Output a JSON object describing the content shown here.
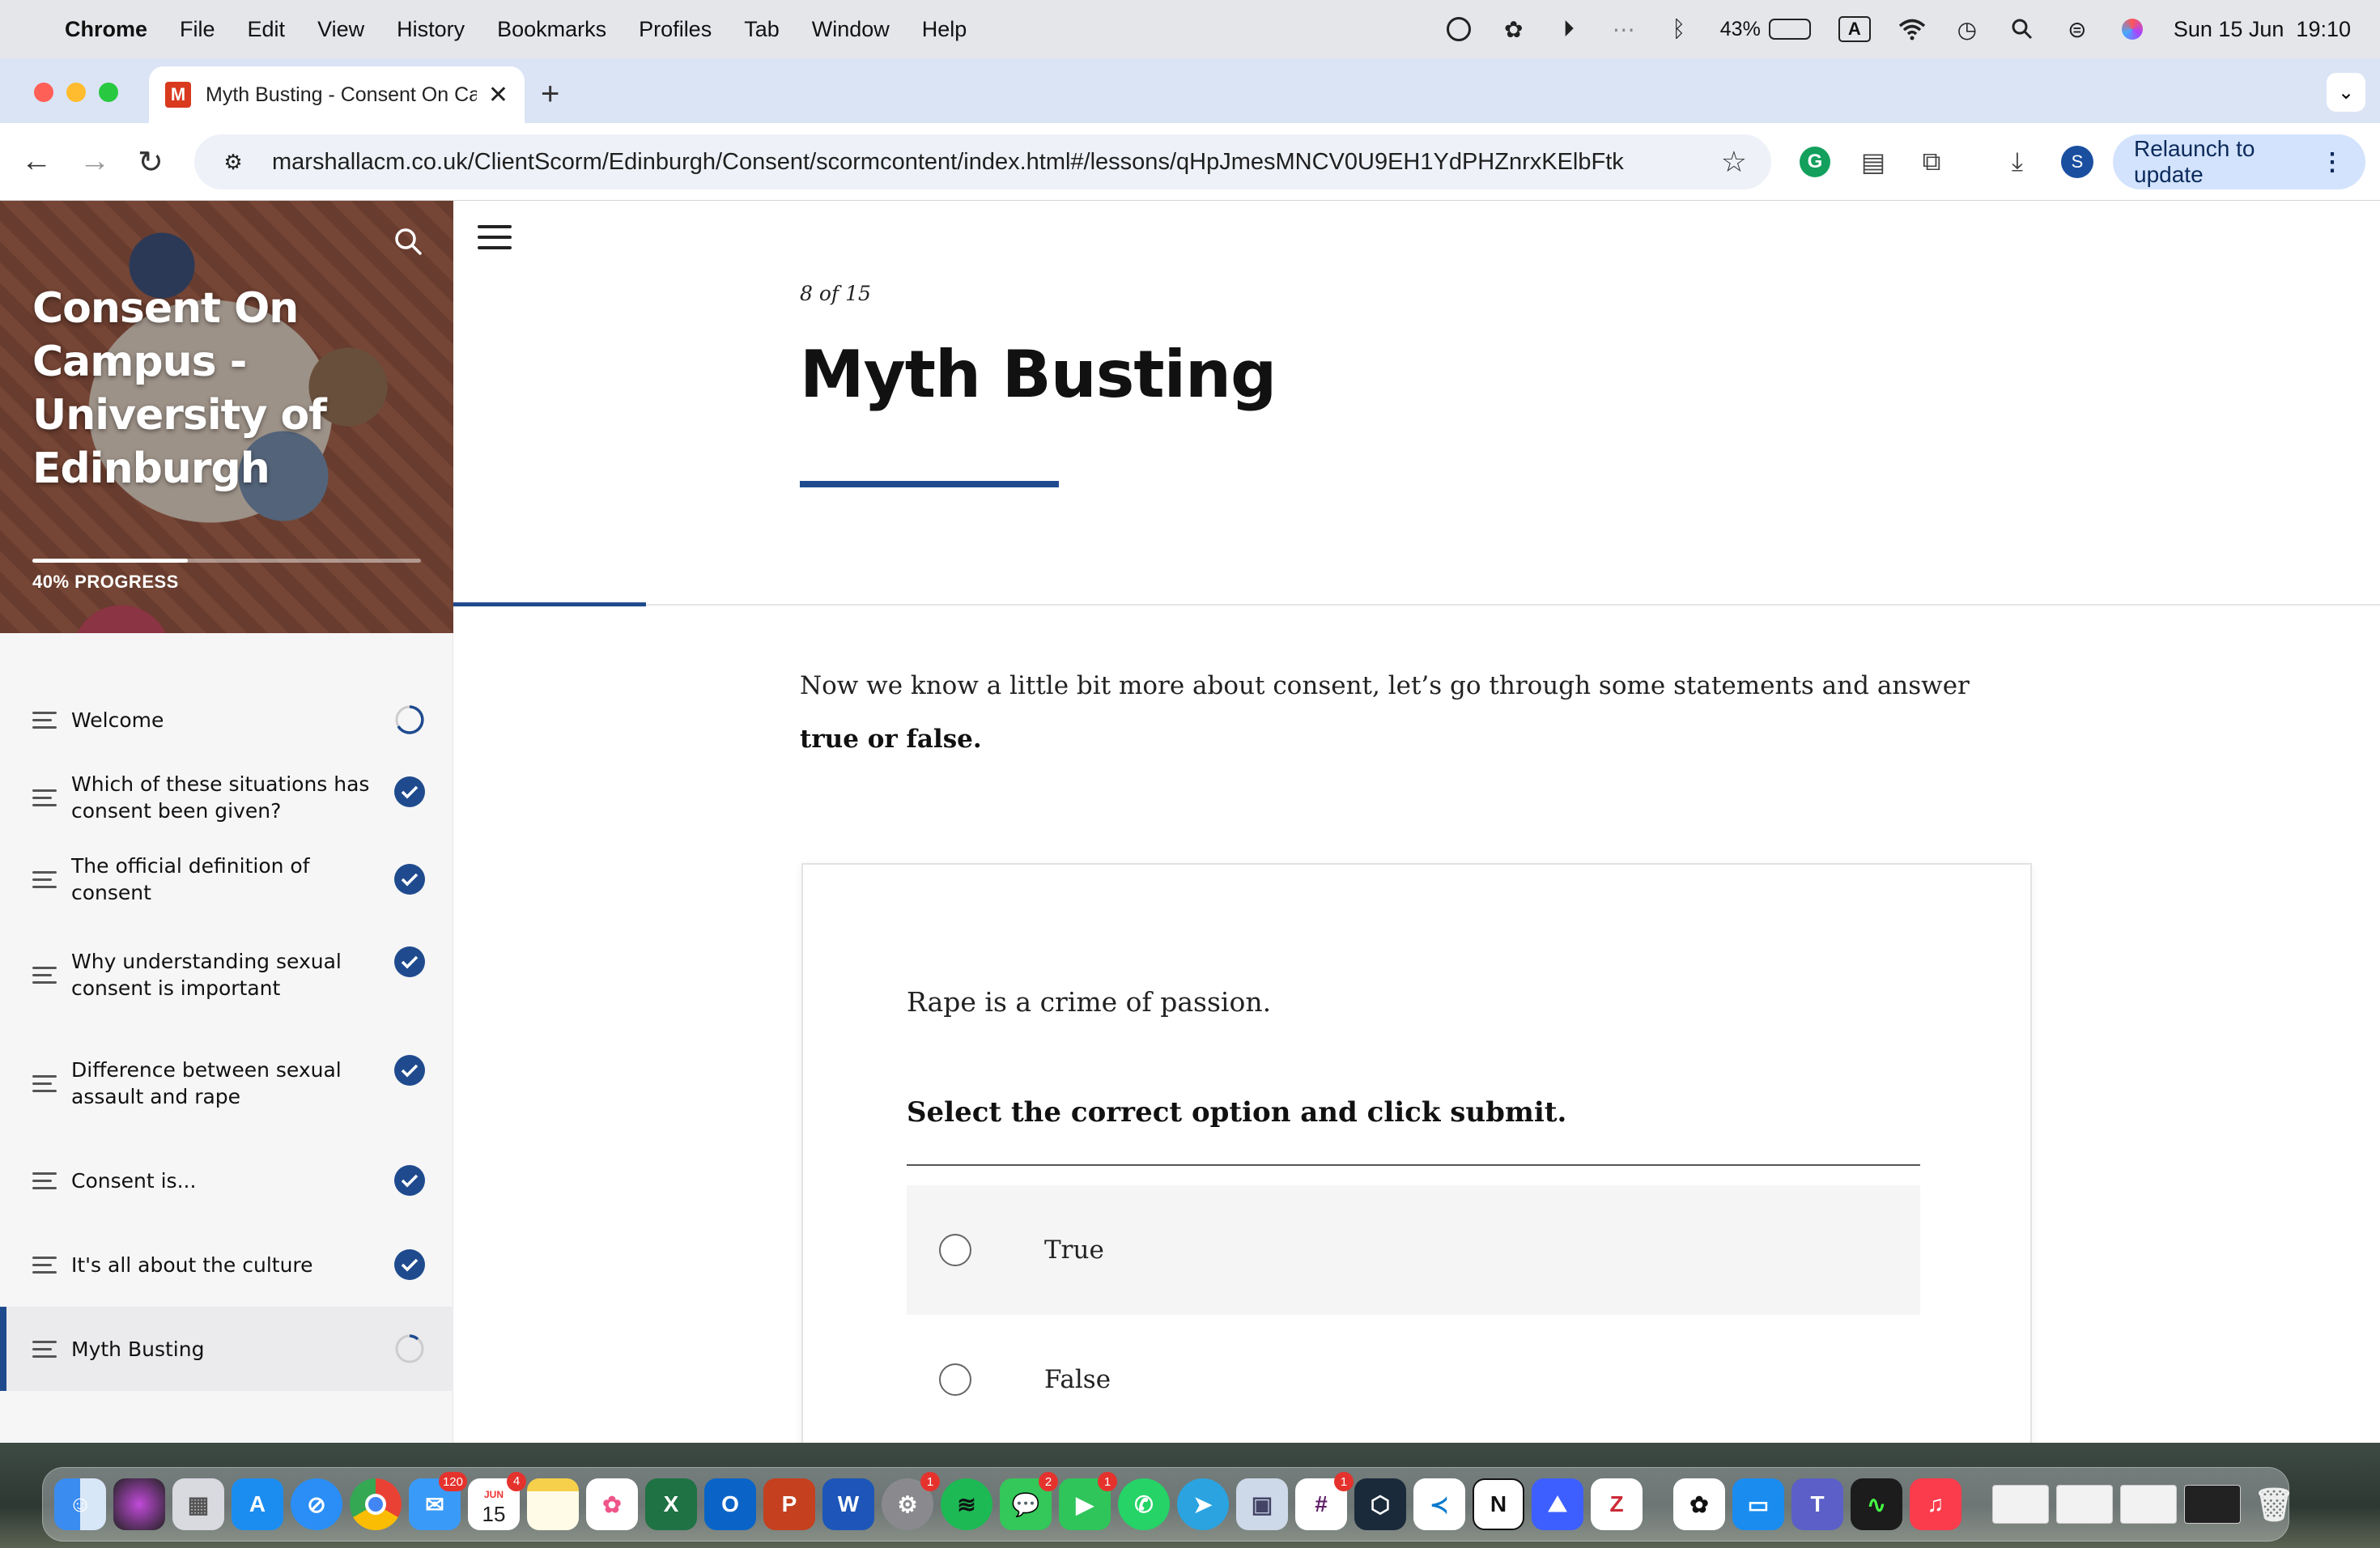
{
  "menubar": {
    "app": "Chrome",
    "items": [
      "File",
      "Edit",
      "View",
      "History",
      "Bookmarks",
      "Profiles",
      "Tab",
      "Window",
      "Help"
    ],
    "battery": "43%",
    "input_source": "A",
    "datetime": "Sun 15 Jun  19:10"
  },
  "browser": {
    "tab_title": "Myth Busting - Consent On Campus",
    "tab_favicon": "M",
    "url": "marshallacm.co.uk/ClientScorm/Edinburgh/Consent/scormcontent/index.html#/lessons/qHpJmesMNCV0U9EH1YdPHZnrxKElbFtk",
    "profile_initial": "S",
    "relaunch_label": "Relaunch to update",
    "colors": {
      "tab_strip": "#dbe4f5",
      "relaunch_bg": "#d3e3fd"
    }
  },
  "sidebar": {
    "course_title": "Consent On Campus - University of Edinburgh",
    "progress_percent": 40,
    "progress_label": "40% PROGRESS",
    "lessons": [
      {
        "label": "Welcome",
        "status": "in-progress"
      },
      {
        "label": "Which of these situations has consent been given?",
        "status": "complete"
      },
      {
        "label": "The official definition of consent",
        "status": "complete"
      },
      {
        "label": "Why understanding sexual consent is important",
        "status": "complete"
      },
      {
        "label": "Difference between sexual assault and rape",
        "status": "complete"
      },
      {
        "label": "Consent is...",
        "status": "complete"
      },
      {
        "label": "It's all about the culture",
        "status": "complete"
      },
      {
        "label": "Myth Busting",
        "status": "in-progress",
        "active": true
      }
    ]
  },
  "lesson": {
    "counter": "8 of 15",
    "title": "Myth Busting",
    "intro_text": "Now we know a little bit more about consent, let’s go through some statements and answer ",
    "intro_bold": "true or false.",
    "accent_color": "#1f4b8e"
  },
  "quiz": {
    "statement": "Rape is a crime of passion.",
    "instruction": "Select the correct option and click submit.",
    "options": [
      {
        "label": "True",
        "selected": false
      },
      {
        "label": "False",
        "selected": false
      }
    ]
  },
  "dock": {
    "calendar_month": "JUN",
    "calendar_day": "15",
    "mail_badge": "120",
    "calendar_badge": "4",
    "settings_badge": "1",
    "messages_badge": "2",
    "facetime_badge": "1",
    "slack_badge": "1",
    "notion_label": "N",
    "zotero_label": "Z",
    "excel_label": "X",
    "outlook_label": "O",
    "powerpoint_label": "P",
    "word_label": "W"
  }
}
